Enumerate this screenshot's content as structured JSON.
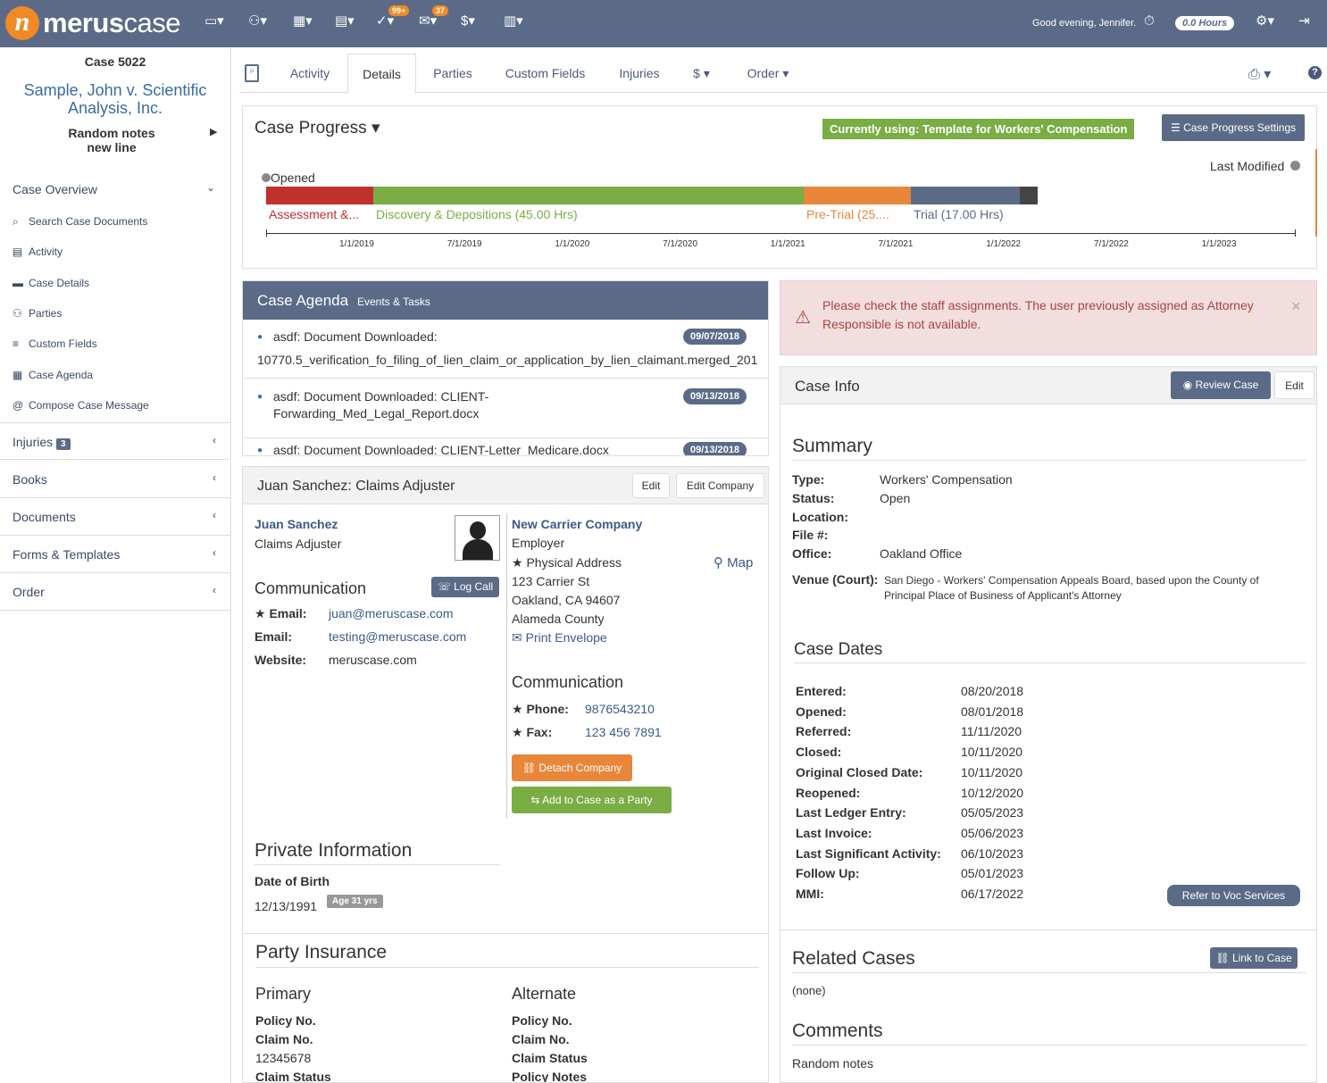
{
  "topbar": {
    "logo_mark": "n",
    "logo_bold": "merus",
    "logo_light": "case",
    "task_badge": "99+",
    "mail_badge": "37",
    "greeting": "Good evening, Jennifer.",
    "hours": "0.0 Hours"
  },
  "sidebar": {
    "case_number": "Case 5022",
    "case_title": "Sample, John v. Scientific Analysis, Inc.",
    "notes": "Random notes\nnew line",
    "overview_label": "Case Overview",
    "sub_items": [
      {
        "icon": "search-icon",
        "label": "Search Case Documents"
      },
      {
        "icon": "activity-icon",
        "label": "Activity"
      },
      {
        "icon": "folder-icon",
        "label": "Case Details"
      },
      {
        "icon": "users-icon",
        "label": "Parties"
      },
      {
        "icon": "list-icon",
        "label": "Custom Fields"
      },
      {
        "icon": "calendar-icon",
        "label": "Case Agenda"
      },
      {
        "icon": "at-icon",
        "label": "Compose Case Message"
      }
    ],
    "injuries_label": "Injuries",
    "injuries_count": "3",
    "books_label": "Books",
    "documents_label": "Documents",
    "forms_label": "Forms & Templates",
    "order_label": "Order"
  },
  "tabs": {
    "activity": "Activity",
    "details": "Details",
    "parties": "Parties",
    "custom_fields": "Custom Fields",
    "injuries": "Injuries",
    "dollar": "$",
    "order": "Order"
  },
  "progress": {
    "title": "Case Progress",
    "template_badge": "Currently using: Template for Workers' Compensation",
    "settings_button": "Case Progress Settings",
    "opened_label": "Opened",
    "last_modified_label": "Last Modified",
    "segments": [
      {
        "label": "Assessment &...",
        "color": "#c0302d",
        "fraction": 0.139
      },
      {
        "label": "Discovery & Depositions (45.00 Hrs)",
        "color": "#7aad44",
        "fraction": 0.558
      },
      {
        "label": "Pre-Trial (25....",
        "color": "#e8863a",
        "fraction": 0.139
      },
      {
        "label": "Trial (17.00 Hrs)",
        "color": "#5b6b87",
        "fraction": 0.141
      },
      {
        "label": "",
        "color": "#444444",
        "fraction": 0.023
      }
    ],
    "axis_ticks": [
      "1/1/2019",
      "7/1/2019",
      "1/1/2020",
      "7/1/2020",
      "1/1/2021",
      "7/1/2021",
      "1/1/2022",
      "7/1/2022",
      "1/1/2023"
    ]
  },
  "agenda": {
    "title": "Case Agenda",
    "subtitle": "Events & Tasks",
    "items": [
      {
        "text": "asdf: Document Downloaded:",
        "detail": "10770.5_verification_fo_filing_of_lien_claim_or_application_by_lien_claimant.merged_201",
        "date": "09/07/2018"
      },
      {
        "text": "asdf: Document Downloaded: CLIENT-",
        "detail": "Forwarding_Med_Legal_Report.docx",
        "date": "09/13/2018"
      },
      {
        "text": "asdf: Document Downloaded: CLIENT-Letter_Medicare.docx",
        "detail": "",
        "date": "09/13/2018"
      }
    ]
  },
  "party": {
    "header": "Juan Sanchez: Claims Adjuster",
    "edit_button": "Edit",
    "edit_company_button": "Edit Company",
    "name": "Juan Sanchez",
    "role": "Claims Adjuster",
    "communication_title": "Communication",
    "log_call_button": "Log Call",
    "email1_label": "Email:",
    "email1": "juan@meruscase.com",
    "email2_label": "Email:",
    "email2": "testing@meruscase.com",
    "website_label": "Website:",
    "website": "meruscase.com",
    "company_name": "New Carrier Company",
    "company_role": "Employer",
    "address_title": "Physical Address",
    "map_link": "Map",
    "address1": "123 Carrier St",
    "address2": "Oakland, CA 94607",
    "address3": "Alameda County",
    "print_envelope": "Print Envelope",
    "company_comm_title": "Communication",
    "phone_label": "Phone:",
    "phone": "9876543210",
    "fax_label": "Fax:",
    "fax": "123 456 7891",
    "detach_button": "Detach Company",
    "add_party_button": "Add to Case as a Party",
    "private_title": "Private Information",
    "dob_label": "Date of Birth",
    "dob": "12/13/1991",
    "age_badge": "Age 31 yrs",
    "insurance_title": "Party Insurance",
    "primary_title": "Primary",
    "alternate_title": "Alternate",
    "policy_label": "Policy No.",
    "claim_label": "Claim No.",
    "claim_value": "12345678",
    "claim_status_label": "Claim Status",
    "policy_notes_label": "Policy Notes"
  },
  "alert": {
    "message": "Please check the staff assignments. The user previously assigned as Attorney Responsible is not available."
  },
  "caseinfo": {
    "title": "Case Info",
    "review_button": "Review Case",
    "edit_button": "Edit",
    "summary_title": "Summary",
    "type_label": "Type:",
    "type": "Workers' Compensation",
    "status_label": "Status:",
    "status": "Open",
    "location_label": "Location:",
    "file_label": "File #:",
    "office_label": "Office:",
    "office": "Oakland Office",
    "venue_label": "Venue (Court):",
    "venue": "San Diego - Workers' Compensation Appeals Board, based upon the County of Principal Place of Business of Applicant's Attorney",
    "dates_title": "Case Dates",
    "dates": [
      {
        "label": "Entered:",
        "value": "08/20/2018"
      },
      {
        "label": "Opened:",
        "value": "08/01/2018"
      },
      {
        "label": "Referred:",
        "value": "11/11/2020"
      },
      {
        "label": "Closed:",
        "value": "10/11/2020"
      },
      {
        "label": "Original Closed Date:",
        "value": "10/11/2020"
      },
      {
        "label": "Reopened:",
        "value": "10/12/2020"
      },
      {
        "label": "Last Ledger Entry:",
        "value": "05/05/2023"
      },
      {
        "label": "Last Invoice:",
        "value": "05/06/2023"
      },
      {
        "label": "Last Significant Activity:",
        "value": "06/10/2023"
      },
      {
        "label": "Follow Up:",
        "value": "05/01/2023"
      },
      {
        "label": "MMI:",
        "value": "06/17/2022"
      }
    ],
    "voc_button": "Refer to Voc Services",
    "related_title": "Related Cases",
    "link_button": "Link to Case",
    "related_none": "(none)",
    "comments_title": "Comments",
    "comments": "Random notes"
  }
}
